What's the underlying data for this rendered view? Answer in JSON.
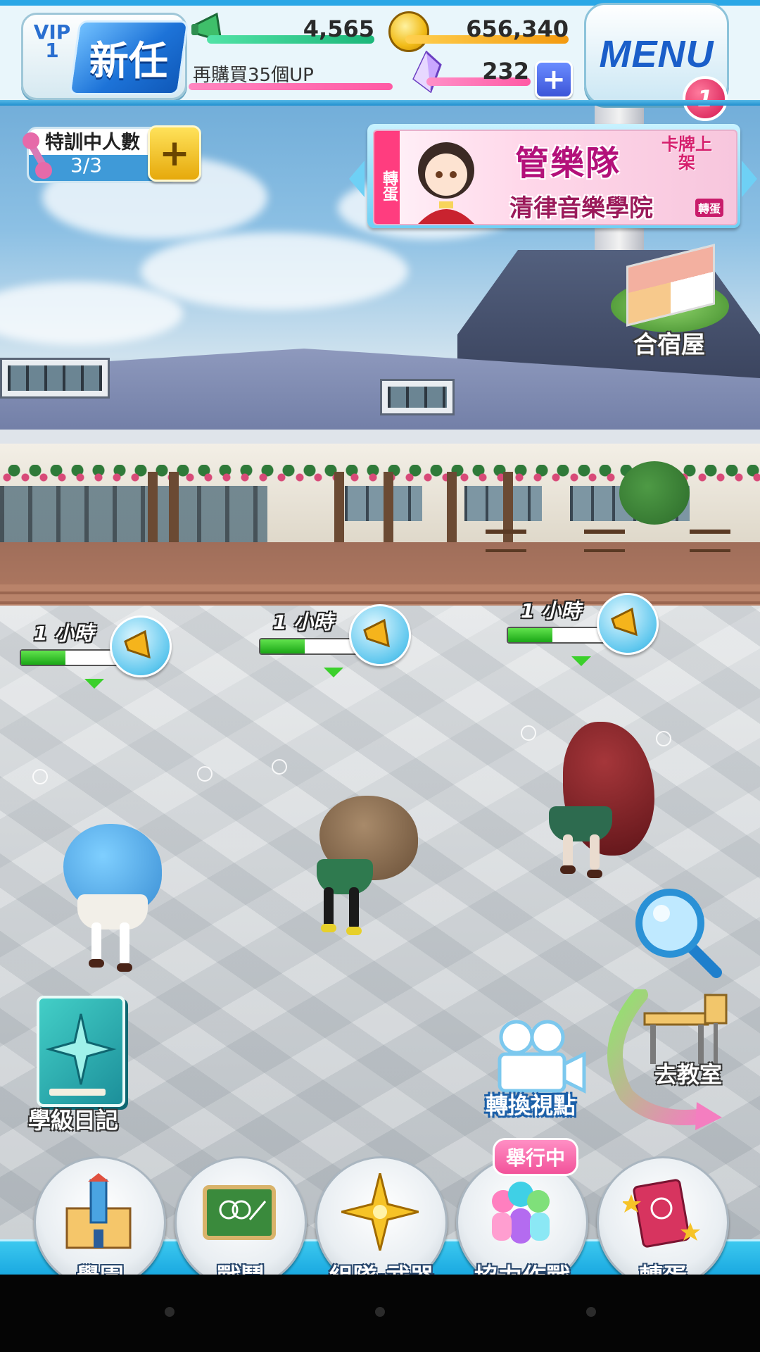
{
  "topbar": {
    "vip_label": "VIP",
    "vip_level": "1",
    "rank_title": "新任",
    "megaphone_count": "4,565",
    "coin_count": "656,340",
    "purchase_hint": "再購買35個UP",
    "gem_count": "232",
    "menu_label": "MENU",
    "menu_badge": "1"
  },
  "training": {
    "label": "特訓中人數",
    "count": "3/3"
  },
  "banner": {
    "tag": "轉蛋",
    "title": "管樂隊",
    "badge": "卡牌上架",
    "subtitle": "清律音樂學院",
    "subtitle_tag": "轉蛋"
  },
  "dorm": {
    "label": "合宿屋"
  },
  "timers": [
    {
      "label": "1 小時",
      "progress": 0.45
    },
    {
      "label": "1 小時",
      "progress": 0.45
    },
    {
      "label": "1 小時",
      "progress": 0.45
    }
  ],
  "side": {
    "camera_label": "轉換視點",
    "classroom_label": "去教室",
    "diary_label": "學級日記"
  },
  "bottom_nav": {
    "event_tag": "舉行中",
    "items": [
      {
        "label": "學園",
        "icon": "school-building-icon"
      },
      {
        "label": "戰鬥",
        "icon": "chalkboard-icon"
      },
      {
        "label": "組隊·武器",
        "icon": "compass-star-icon"
      },
      {
        "label": "協力作戰",
        "icon": "co-op-figures-icon"
      },
      {
        "label": "轉蛋",
        "icon": "gacha-book-icon"
      }
    ]
  },
  "colors": {
    "accent_blue": "#1a5ec9",
    "gacha_pink": "#ff3d7f",
    "progress_green": "#1aa616",
    "gold": "#e6a90b"
  }
}
